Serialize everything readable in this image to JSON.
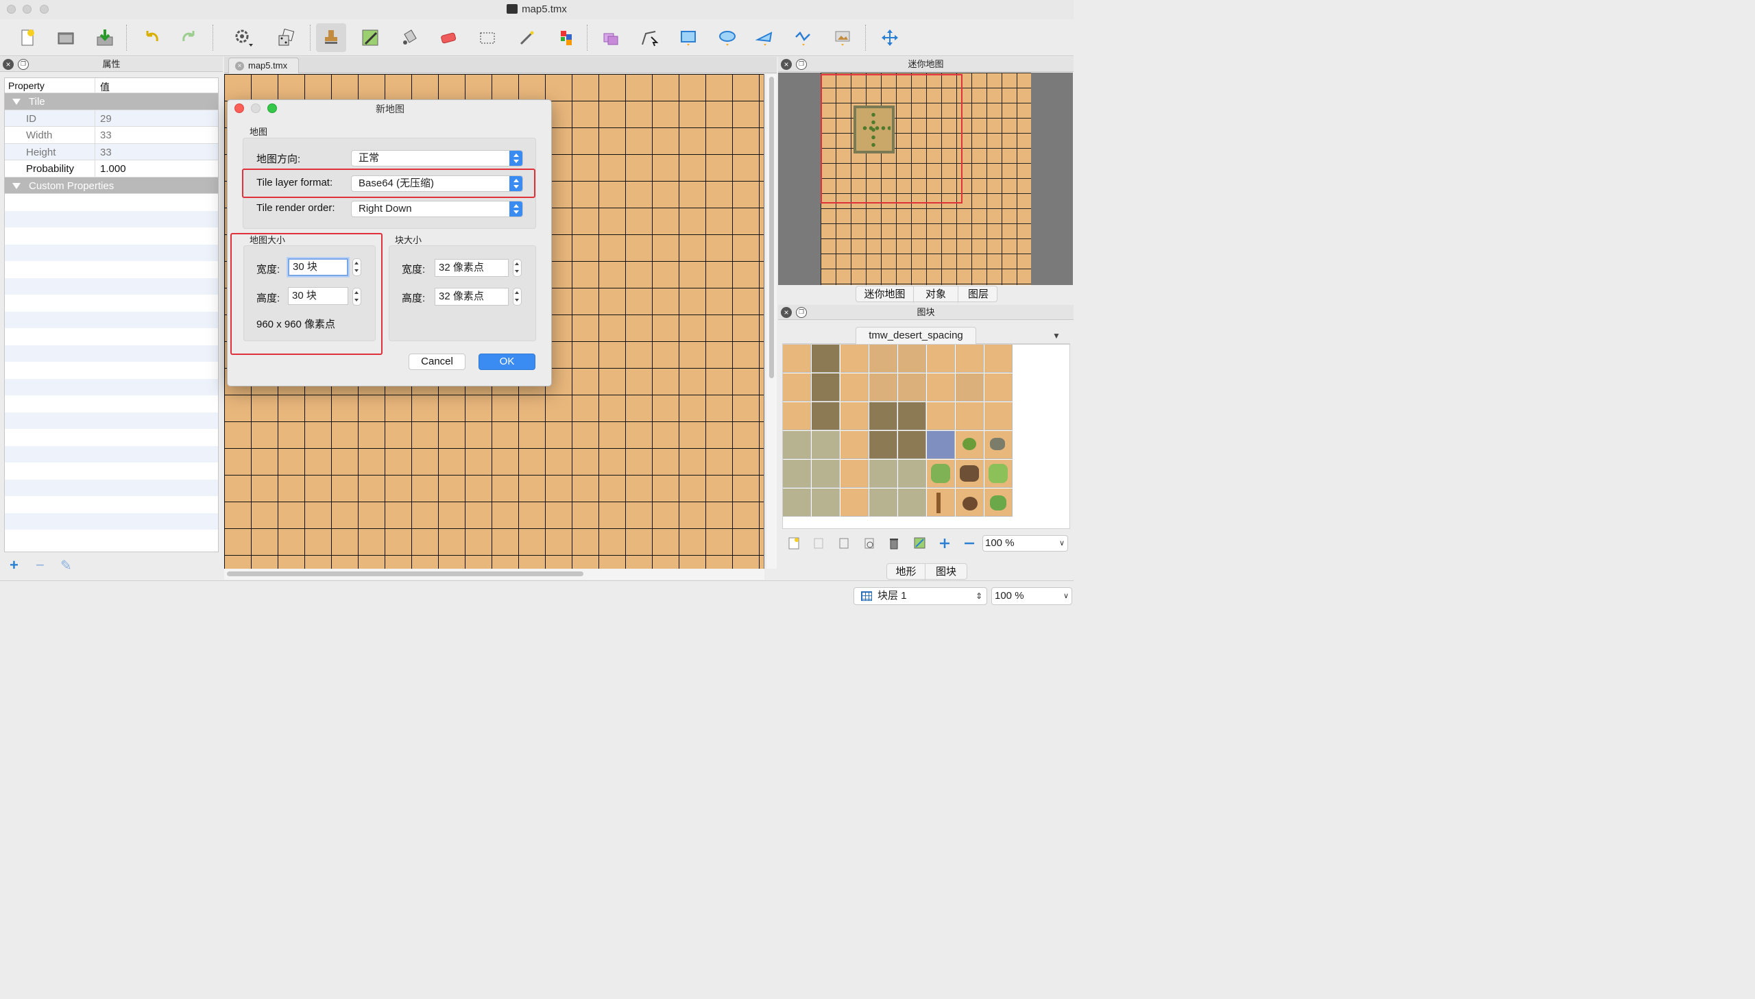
{
  "window": {
    "title": "map5.tmx"
  },
  "toolbar": {
    "tools": [
      {
        "name": "new-map"
      },
      {
        "name": "open-file"
      },
      {
        "name": "save"
      },
      {
        "name": "undo"
      },
      {
        "name": "redo"
      },
      {
        "name": "commands"
      },
      {
        "name": "random-mode"
      },
      {
        "name": "stamp-brush"
      },
      {
        "name": "terrain-brush"
      },
      {
        "name": "bucket-fill"
      },
      {
        "name": "eraser"
      },
      {
        "name": "rectangular-select"
      },
      {
        "name": "magic-wand"
      },
      {
        "name": "select-same-tile"
      },
      {
        "name": "select-objects"
      },
      {
        "name": "edit-polygons"
      },
      {
        "name": "insert-rectangle"
      },
      {
        "name": "insert-ellipse"
      },
      {
        "name": "insert-polygon"
      },
      {
        "name": "insert-polyline"
      },
      {
        "name": "insert-tile"
      },
      {
        "name": "move"
      }
    ]
  },
  "properties_dock": {
    "title": "属性",
    "columns": {
      "property": "Property",
      "value": "值"
    },
    "groups": [
      {
        "label": "Tile",
        "rows": [
          {
            "key": "ID",
            "value": "29"
          },
          {
            "key": "Width",
            "value": "33"
          },
          {
            "key": "Height",
            "value": "33"
          },
          {
            "key": "Probability",
            "value": "1.000"
          }
        ]
      },
      {
        "label": "Custom Properties",
        "rows": []
      }
    ],
    "buttons": {
      "add": "+",
      "remove": "−",
      "edit": "✎"
    }
  },
  "map_tab": {
    "label": "map5.tmx"
  },
  "dialog": {
    "title": "新地图",
    "map_section": "地图",
    "orientation": {
      "label": "地图方向:",
      "value": "正常"
    },
    "layer_format": {
      "label": "Tile layer format:",
      "value": "Base64 (无压缩)"
    },
    "render_order": {
      "label": "Tile render order:",
      "value": "Right Down"
    },
    "map_size": {
      "title": "地图大小",
      "width_label": "宽度:",
      "width_value": "30 块",
      "height_label": "高度:",
      "height_value": "30 块",
      "summary": "960 x 960 像素点"
    },
    "tile_size": {
      "title": "块大小",
      "width_label": "宽度:",
      "width_value": "32 像素点",
      "height_label": "高度:",
      "height_value": "32 像素点"
    },
    "cancel": "Cancel",
    "ok": "OK"
  },
  "minimap_dock": {
    "title": "迷你地图",
    "tabs": [
      "迷你地图",
      "对象",
      "图层"
    ]
  },
  "tileset_dock": {
    "title": "图块",
    "tileset_name": "tmw_desert_spacing",
    "zoom": "100 %",
    "tabs": [
      "地形",
      "图块"
    ]
  },
  "status": {
    "layer": "块层 1",
    "zoom": "100 %"
  },
  "colors": {
    "accent": "#3b8cf2",
    "highlight": "#e0303a",
    "sand": "#e8b77c"
  }
}
